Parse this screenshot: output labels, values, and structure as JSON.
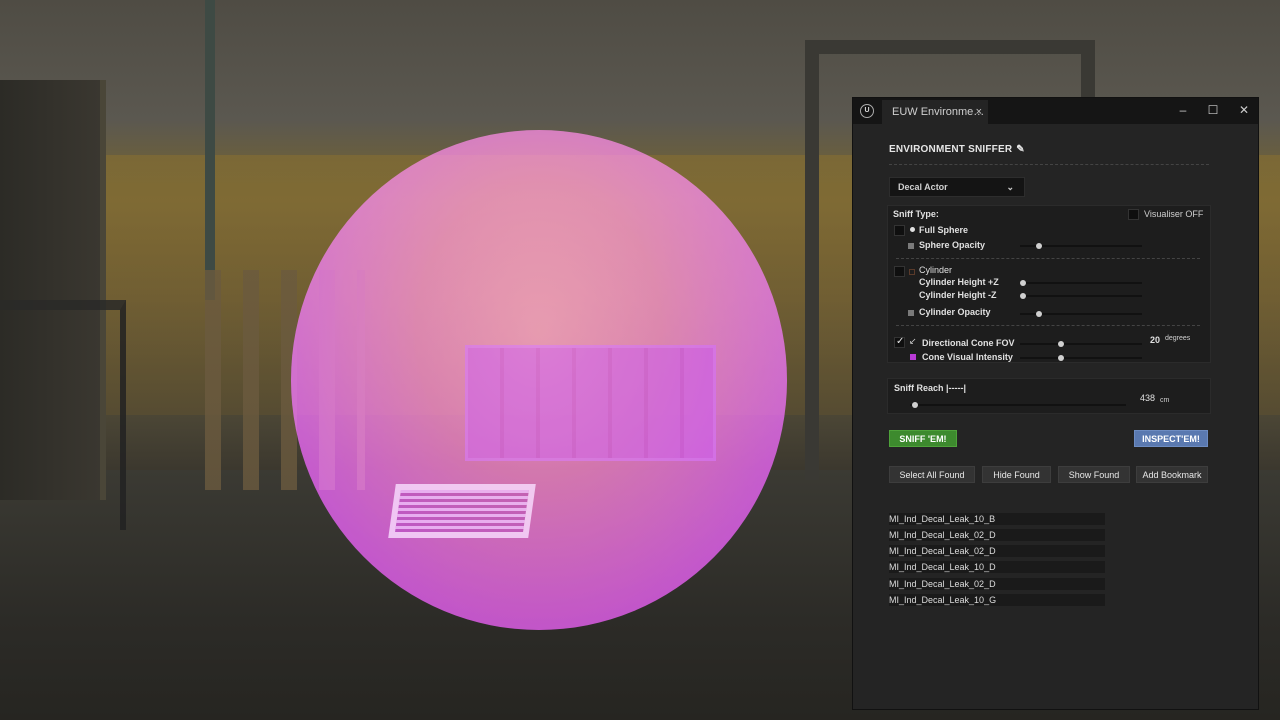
{
  "window": {
    "tab_title": "EUW Environme…",
    "tab_close": "×",
    "minimize": "–",
    "maximize": "☐",
    "close": "✕",
    "logo": "U"
  },
  "panel": {
    "heading": "ENVIRONMENT SNIFFER",
    "heading_icon": "✎",
    "actor_dropdown": {
      "value": "Decal Actor",
      "chevron": "⌄"
    },
    "sniff_type": {
      "label": "Sniff Type:",
      "visualiser_label": "Visualiser OFF",
      "visualiser_checked": false,
      "full_sphere": {
        "label": "Full Sphere",
        "checked": false
      },
      "sphere_opacity": {
        "label": "Sphere Opacity",
        "value": 0.15,
        "color": "#7a7a7a"
      },
      "cylinder": {
        "label": "Cylinder",
        "checked": false
      },
      "cylinder_height_pos": {
        "label": "Cylinder Height +Z",
        "value": 0.0
      },
      "cylinder_height_neg": {
        "label": "Cylinder Height -Z",
        "value": 0.0
      },
      "cylinder_opacity": {
        "label": "Cylinder Opacity",
        "value": 0.15,
        "color": "#7a7a7a"
      },
      "directional_cone": {
        "label": "Directional Cone FOV",
        "checked": true,
        "value": "20",
        "unit": "degrees",
        "fraction": 0.3,
        "icon": "↙"
      },
      "cone_visual_intensity": {
        "label": "Cone Visual Intensity",
        "value": 0.3,
        "color": "#b93ad6"
      }
    },
    "sniff_reach": {
      "label": "Sniff Reach |-----|",
      "value": "438",
      "unit": "cm",
      "fraction": 0.0
    },
    "buttons": {
      "sniff": "SNIFF 'EM!",
      "inspect": "INSPECT'EM!",
      "select_all": "Select All Found",
      "hide": "Hide Found",
      "show": "Show Found",
      "bookmark": "Add Bookmark"
    },
    "results": [
      "MI_Ind_Decal_Leak_10_B",
      "MI_Ind_Decal_Leak_02_D",
      "MI_Ind_Decal_Leak_02_D",
      "MI_Ind_Decal_Leak_10_D",
      "MI_Ind_Decal_Leak_02_D",
      "MI_Ind_Decal_Leak_10_G"
    ]
  },
  "colors": {
    "green_button": "#3d8a2e",
    "blue_button": "#5a79b0",
    "sphere": "#d34fd8"
  }
}
